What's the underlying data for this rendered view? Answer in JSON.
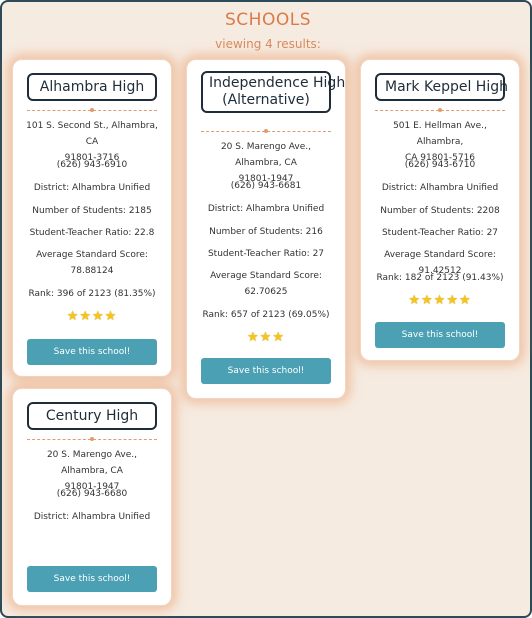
{
  "page": {
    "title": "SCHOOLS",
    "results_count": "viewing 4 results:"
  },
  "schools": [
    {
      "name": "Alhambra High",
      "address_line1": "101 S. Second St., Alhambra, CA",
      "address_line2": "91801-3716",
      "phone": "(626) 943-6910",
      "district": "District: Alhambra Unified",
      "students": "Number of Students: 2185",
      "ratio": "Student-Teacher Ratio: 22.8",
      "avg_score_label": "Average Standard Score:",
      "avg_score_value": "78.88124",
      "rank": "Rank: 396 of 2123 (81.35%)",
      "stars": 4,
      "save_label": "Save this school!"
    },
    {
      "name_line1": "Independence High",
      "name_line2": "(Alternative)",
      "address_line1": "20 S. Marengo Ave., Alhambra, CA",
      "address_line2": "91801-1947",
      "phone": "(626) 943-6681",
      "district": "District: Alhambra Unified",
      "students": "Number of Students: 216",
      "ratio": "Student-Teacher Ratio: 27",
      "avg_score_label": "Average Standard Score:",
      "avg_score_value": "62.70625",
      "rank": "Rank: 657 of 2123 (69.05%)",
      "stars": 3,
      "save_label": "Save this school!"
    },
    {
      "name": "Mark Keppel High",
      "address_line1": "501 E. Hellman Ave., Alhambra,",
      "address_line2": "CA 91801-5716",
      "phone": "(626) 943-6710",
      "district": "District: Alhambra Unified",
      "students": "Number of Students: 2208",
      "ratio": "Student-Teacher Ratio: 27",
      "avg_score": "Average Standard Score: 91.42512",
      "rank": "Rank: 182 of 2123 (91.43%)",
      "stars": 5,
      "save_label": "Save this school!"
    },
    {
      "name": "Century High",
      "address_line1": "20 S. Marengo Ave., Alhambra, CA",
      "address_line2": "91801-1947",
      "phone": "(626) 943-6680",
      "district": "District: Alhambra Unified",
      "save_label": "Save this school!"
    }
  ]
}
